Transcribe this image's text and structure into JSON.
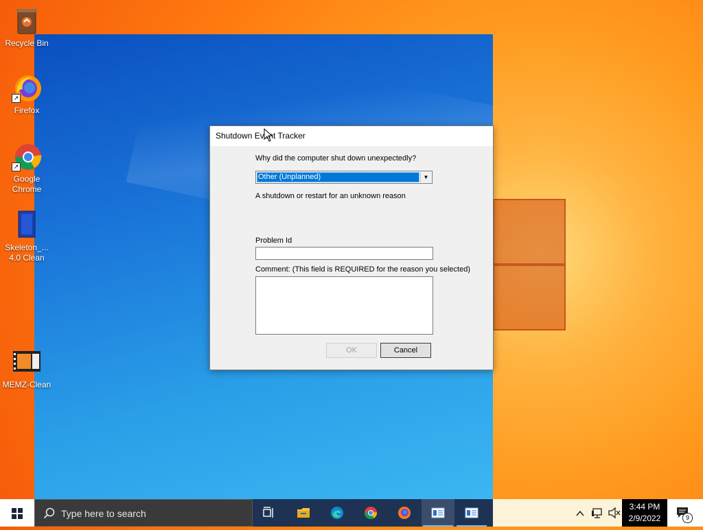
{
  "desktop": {
    "icons": [
      {
        "label": "Recycle Bin"
      },
      {
        "label": "Firefox"
      },
      {
        "label": "Google Chrome"
      },
      {
        "label": "Skeleton_... 4.0 Clean"
      },
      {
        "label": "MEMZ-Clean"
      }
    ]
  },
  "dialog": {
    "title": "Shutdown Event Tracker",
    "question": "Why did the computer shut down unexpectedly?",
    "reason_selected": "Other (Unplanned)",
    "reason_description": "A shutdown or restart for an unknown reason",
    "problem_id_label": "Problem Id",
    "problem_id_value": "",
    "comment_label": "Comment: (This field is REQUIRED for the reason you selected)",
    "comment_value": "",
    "ok_label": "OK",
    "cancel_label": "Cancel"
  },
  "taskbar": {
    "search_placeholder": "Type here to search",
    "apps": [
      "task-view-icon",
      "file-explorer-icon",
      "edge-icon",
      "chrome-icon",
      "firefox-icon",
      "window-app-icon",
      "window-app-icon"
    ],
    "clock_time": "3:44 PM",
    "clock_date": "2/9/2022",
    "notification_count": "9"
  },
  "colors": {
    "accent": "#0078d7",
    "taskbar": "#1b2538",
    "desktop_orange": "#ff9a1e"
  }
}
